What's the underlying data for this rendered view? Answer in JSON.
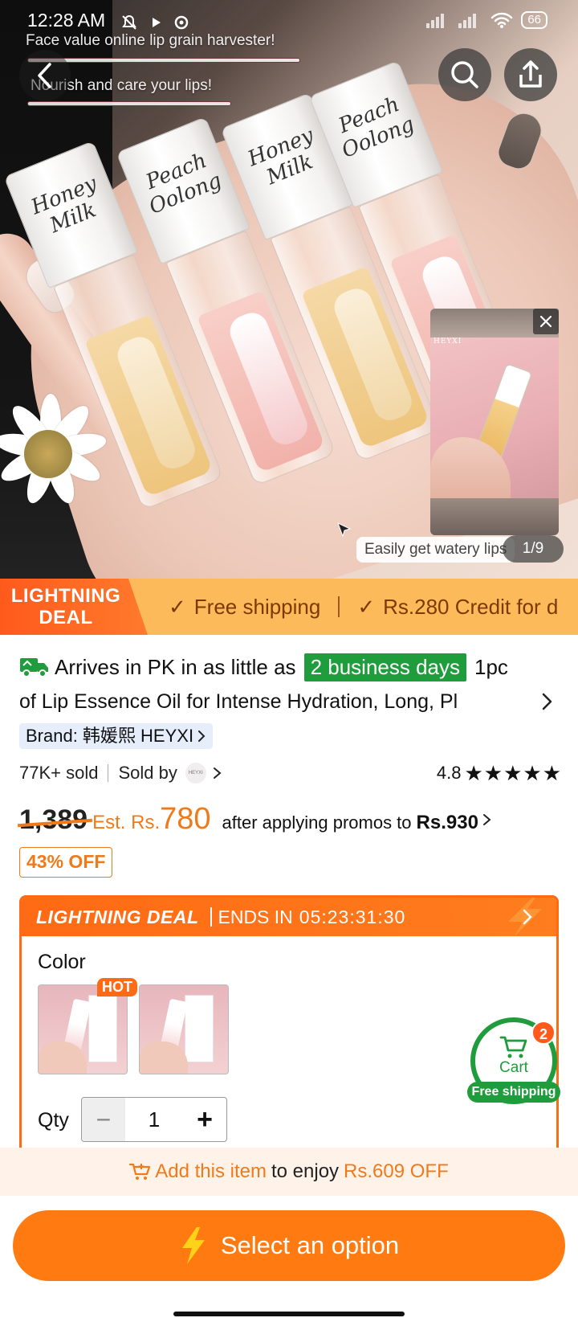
{
  "status": {
    "time": "12:28 AM",
    "battery": "66"
  },
  "hero": {
    "banner_line1": "Face value online lip grain harvester!",
    "banner_line2": "Nourish and care your lips!",
    "bottle_labels": [
      "Honey Milk",
      "Peach Oolong",
      "Honey Milk",
      "Peach Oolong"
    ],
    "pip_brand": "HEYXI",
    "caption": "Easily get watery lips",
    "pager": "1/9"
  },
  "deal_strip": {
    "badge_line1": "LIGHTNING",
    "badge_line2": "DEAL",
    "feature1": "Free shipping",
    "feature2": "Rs.280 Credit for d"
  },
  "product": {
    "arrives_text": "Arrives in PK in as little as",
    "arrives_badge": "2 business days",
    "title_start": "1pc",
    "title_line": "of Lip Essence Oil for Intense Hydration, Long, Pl",
    "brand_label": "Brand: 韩媛熙 HEYXI",
    "sold": "77K+ sold",
    "sold_by": "Sold by",
    "seller_logo": "HEYXI",
    "rating": "4.8",
    "stars": "★★★★★",
    "old_price": "1,389",
    "est_label": "Est. Rs.",
    "est_price": "780",
    "promo_text": "after applying promos to",
    "promo_price": "Rs.930",
    "discount": "43% OFF"
  },
  "lightning_panel": {
    "title": "LIGHTNING DEAL",
    "ends_label": "ENDS IN",
    "countdown": "05:23:31:30",
    "color_label": "Color",
    "hot": "HOT",
    "qty_label": "Qty",
    "qty_value": "1",
    "minus": "−",
    "plus": "+"
  },
  "cart": {
    "label": "Cart",
    "count": "2",
    "shipping": "Free shipping"
  },
  "promo_bar": {
    "link": "Add this item",
    "middle": "to enjoy",
    "amount": "Rs.609 OFF"
  },
  "cta": {
    "label": "Select an option"
  },
  "colors": {
    "accent": "#ff7a10",
    "deal_orange": "#ff6a14",
    "green": "#1f9d3c",
    "strip": "#fdba5a"
  }
}
